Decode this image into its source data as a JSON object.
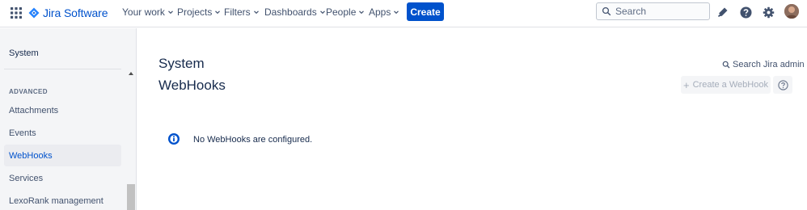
{
  "topnav": {
    "logo_text": "Jira Software",
    "items": [
      {
        "label": "Your work"
      },
      {
        "label": "Projects"
      },
      {
        "label": "Filters"
      },
      {
        "label": "Dashboards"
      },
      {
        "label": "People"
      },
      {
        "label": "Apps"
      }
    ],
    "create_label": "Create",
    "search_placeholder": "Search",
    "icons": [
      "app-switcher-icon",
      "notifications-icon",
      "help-icon",
      "settings-icon",
      "avatar"
    ]
  },
  "sidebar": {
    "section_link": "System",
    "heading": "ADVANCED",
    "items": [
      {
        "label": "Attachments",
        "active": false
      },
      {
        "label": "Events",
        "active": false
      },
      {
        "label": "WebHooks",
        "active": true
      },
      {
        "label": "Services",
        "active": false
      },
      {
        "label": "LexoRank management",
        "active": false
      }
    ]
  },
  "main": {
    "breadcrumb": "System",
    "title": "WebHooks",
    "search_admin_label": "Search Jira admin",
    "create_webhook_label": "Create a WebHook",
    "empty_message": "No WebHooks are configured."
  },
  "colors": {
    "brand": "#0052cc",
    "text": "#172b4d",
    "sidebar_bg": "#f4f5f7",
    "active_bg": "#ebecf0"
  }
}
